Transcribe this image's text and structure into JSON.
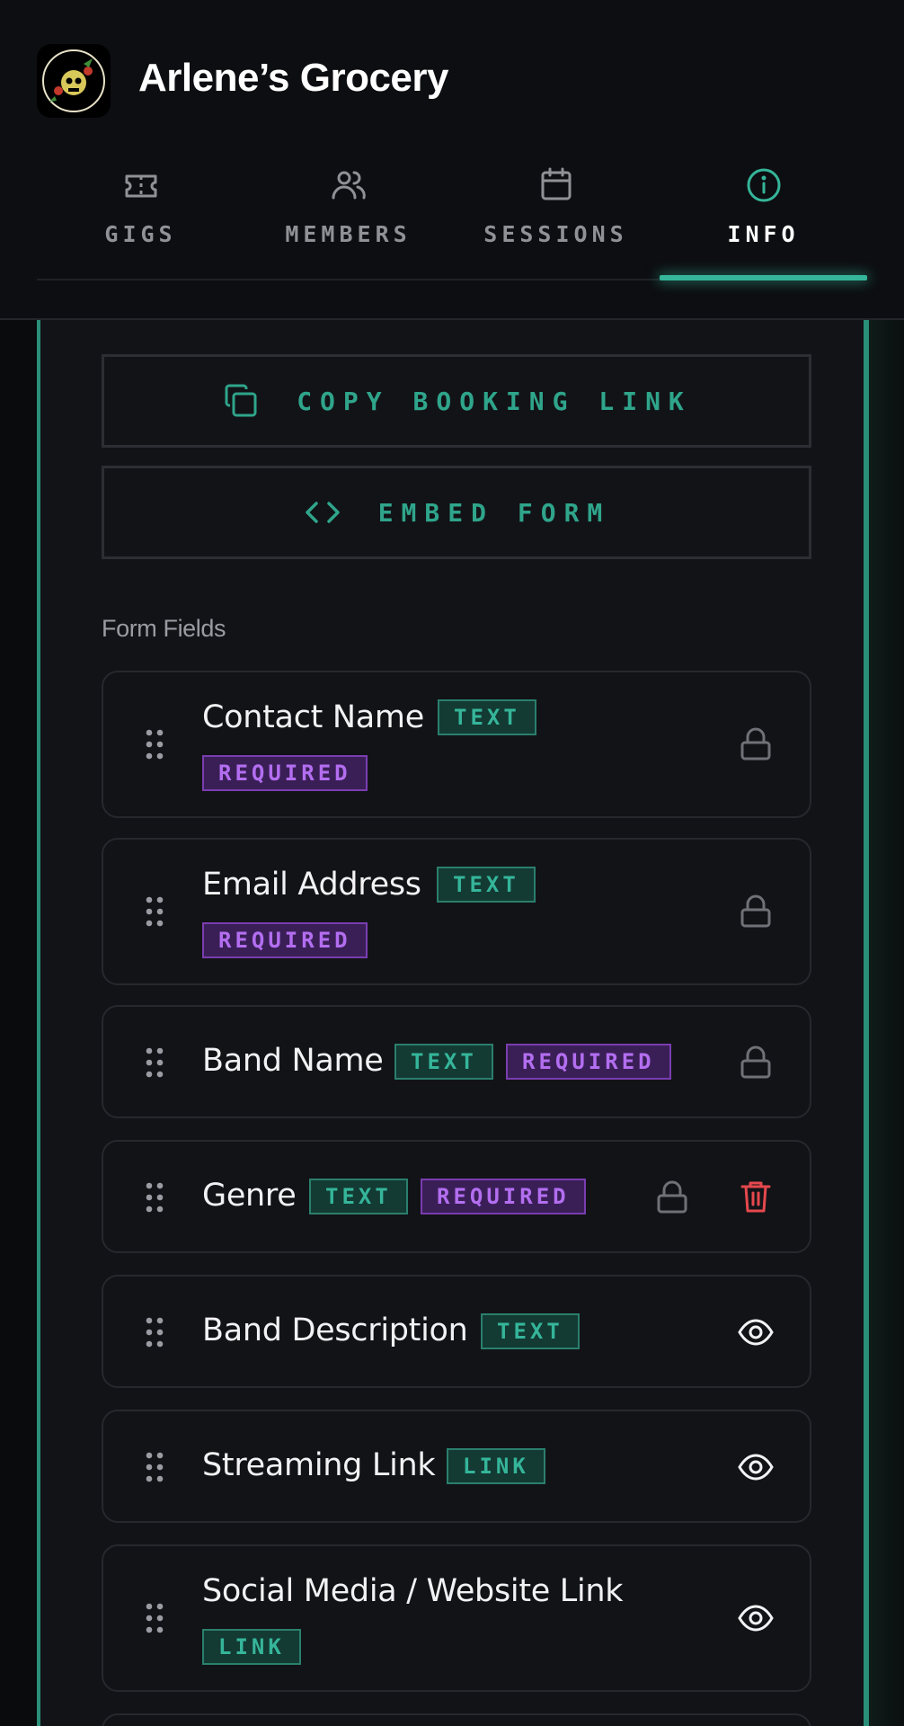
{
  "app": {
    "title": "Arlene’s Grocery"
  },
  "tabs": [
    {
      "label": "GIGS",
      "icon": "ticket-icon",
      "active": false
    },
    {
      "label": "MEMBERS",
      "icon": "users-icon",
      "active": false
    },
    {
      "label": "SESSIONS",
      "icon": "calendar-icon",
      "active": false
    },
    {
      "label": "INFO",
      "icon": "info-icon",
      "active": true
    }
  ],
  "actions": {
    "copy_booking_link": "COPY BOOKING LINK",
    "embed_form": "EMBED FORM"
  },
  "form_fields": {
    "title": "Form Fields",
    "items": [
      {
        "name": "Contact Name",
        "type": "TEXT",
        "required": "REQUIRED",
        "state": "lock-icon"
      },
      {
        "name": "Email Address",
        "type": "TEXT",
        "required": "REQUIRED",
        "state": "lock-icon"
      },
      {
        "name": "Band Name",
        "type": "TEXT",
        "required": "REQUIRED",
        "state": "lock-icon"
      },
      {
        "name": "Genre",
        "type": "TEXT",
        "required": "REQUIRED",
        "state": "lock-icon",
        "delete": "trash-icon"
      },
      {
        "name": "Band Description",
        "type": "TEXT",
        "state": "eye-icon"
      },
      {
        "name": "Streaming Link",
        "type": "LINK",
        "state": "eye-icon"
      },
      {
        "name": "Social Media / Website Link",
        "type": "LINK",
        "state": "eye-icon"
      }
    ]
  },
  "colors": {
    "accent": "#35b59a",
    "required": "#b36ef0",
    "danger": "#e5484d",
    "background": "#121317"
  }
}
